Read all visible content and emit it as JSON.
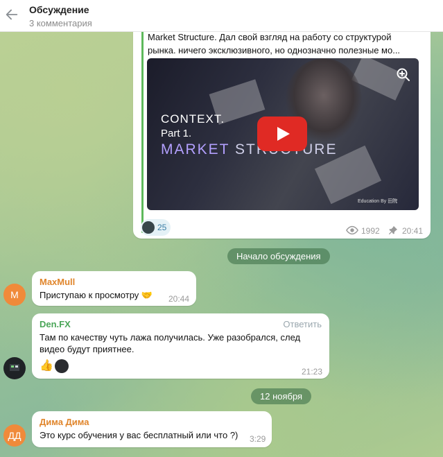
{
  "header": {
    "title": "Обсуждение",
    "subtitle": "3 комментария"
  },
  "post": {
    "text_line1": "Market Structure. Дал свой взгляд на работу со структурой",
    "text_line2": "рынка. ничего эксклюзивного, но однозначно полезные мо...",
    "video": {
      "brand": "CONTEXT.",
      "part": "Part 1.",
      "headline_word1": "MARKET",
      "headline_word2": "STRUCTURE",
      "credit": "Education By 田院"
    },
    "reaction_count": "25",
    "views": "1992",
    "time": "20:41"
  },
  "divider_discussion": "Начало обсуждения",
  "messages": [
    {
      "author": "MaxMull",
      "avatar_initials": "M",
      "avatar_color": "#f08a3a",
      "author_color": "#e0852b",
      "text": "Приступаю к просмотру 🤝",
      "time": "20:44"
    },
    {
      "author": "Den.FX",
      "author_color": "#4aa658",
      "reply_label": "Ответить",
      "text_line1": "Там по качеству чуть лажа получилась. Уже разобрался, след",
      "text_line2": "видео будут приятнее.",
      "reaction": "👍",
      "time": "21:23"
    },
    {
      "author": "Дима Дима",
      "avatar_initials": "ДД",
      "avatar_color": "#f08a3a",
      "author_color": "#e0852b",
      "text": "Это курс обучения у вас бесплатный или что ?)",
      "time": "3:29"
    }
  ],
  "divider_date": "12 ноября"
}
